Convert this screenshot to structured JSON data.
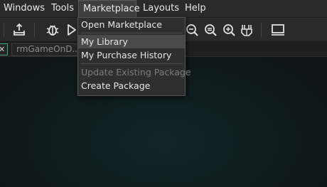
{
  "menubar": {
    "items": [
      {
        "label": "Windows"
      },
      {
        "label": "Tools"
      },
      {
        "label": "Marketplace"
      },
      {
        "label": "Layouts"
      },
      {
        "label": "Help"
      }
    ],
    "active_item": "Marketplace"
  },
  "toolbar": {
    "icons": [
      "export-icon",
      "debug-icon",
      "run-icon",
      "zoom-out-icon",
      "zoom-reset-icon",
      "zoom-in-icon",
      "gamepad-icon",
      "monitor-icon"
    ]
  },
  "tabs": {
    "items": [
      {
        "label": "rmGameOnD..."
      }
    ],
    "close_glyph": "✕"
  },
  "dropdown": {
    "items": [
      {
        "label": "Open Marketplace",
        "enabled": true
      },
      {
        "label": "My Library",
        "enabled": true,
        "highlighted": true
      },
      {
        "label": "My Purchase History",
        "enabled": true
      },
      {
        "label": "Update Existing Package",
        "enabled": false
      },
      {
        "label": "Create Package",
        "enabled": true
      }
    ]
  },
  "colors": {
    "menubar_bg": "#2a2a2a",
    "dropdown_bg": "#2f2f2f",
    "highlight_bg": "#4a4a4a",
    "accent_teal": "#3aa38a",
    "workspace_bg": "#0f1b1e"
  }
}
